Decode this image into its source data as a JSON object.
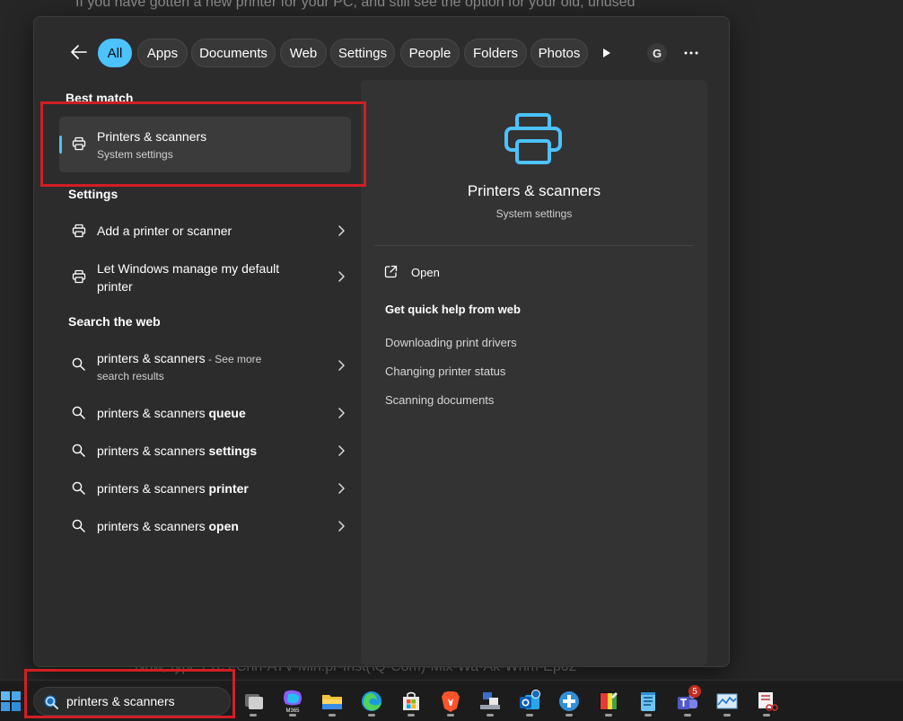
{
  "background": {
    "top_text": "If you have gotten a new printer for your PC, and still see the option for your old, unused",
    "bottom_text": "Now, type ERS-Cnn-ATV-Min.pr-Inst(\\Q-Com)-Mix-Wa-Ak-Whm-Ep02"
  },
  "filters": [
    "All",
    "Apps",
    "Documents",
    "Web",
    "Settings",
    "People",
    "Folders",
    "Photos"
  ],
  "account_initial": "G",
  "best_match": {
    "heading": "Best match",
    "title": "Printers & scanners",
    "subtitle": "System settings"
  },
  "settings": {
    "heading": "Settings",
    "items": [
      {
        "label": "Add a printer or scanner"
      },
      {
        "label_line1": "Let Windows manage my default",
        "label_line2": "printer"
      }
    ]
  },
  "web": {
    "heading": "Search the web",
    "first": {
      "query": "printers & scanners",
      "suffix_a": " - See more",
      "suffix_b": "search results"
    },
    "suggestions": [
      {
        "query": "printers & scanners ",
        "bold": "queue"
      },
      {
        "query": "printers & scanners ",
        "bold": "settings"
      },
      {
        "query": "printers & scanners ",
        "bold": "printer"
      },
      {
        "query": "printers & scanners ",
        "bold": "open"
      }
    ]
  },
  "details": {
    "title": "Printers & scanners",
    "subtitle": "System settings",
    "open_label": "Open",
    "quick_help": "Get quick help from web",
    "links": [
      "Downloading print drivers",
      "Changing printer status",
      "Scanning documents"
    ]
  },
  "taskbar": {
    "search_value": "printers & scanners",
    "teams_badge": "5"
  },
  "colors": {
    "accent": "#4cc2ff",
    "annotation": "#d01f23"
  }
}
